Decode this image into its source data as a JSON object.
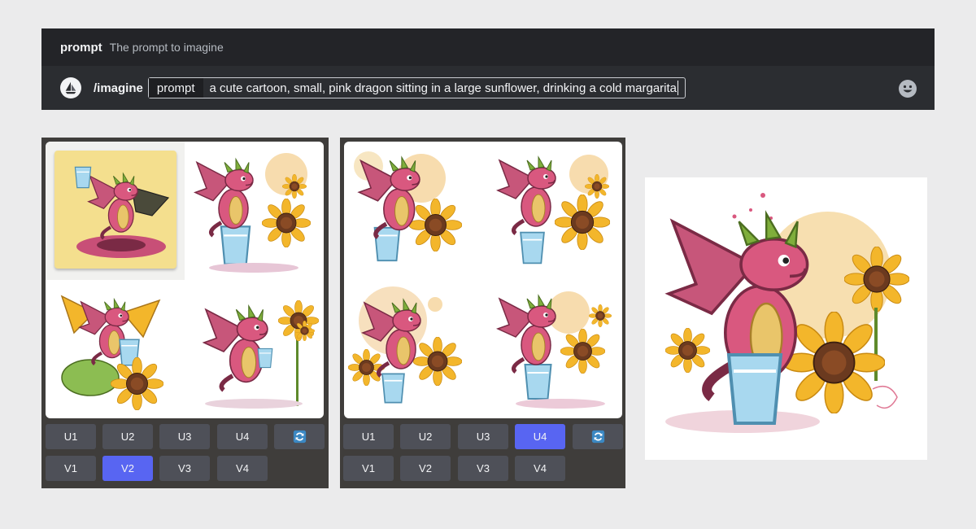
{
  "command": {
    "option_name": "prompt",
    "option_description": "The prompt to imagine",
    "slash_command": "/imagine",
    "prompt_chip": "prompt",
    "prompt_value": "a cute cartoon, small, pink dragon sitting in a large sunflower, drinking a cold margarita"
  },
  "icons": {
    "bot_avatar": "sailboat-icon",
    "emoji": "smiley-emoji-icon",
    "refresh": "refresh-icon"
  },
  "panel_left": {
    "upscale_buttons": [
      "U1",
      "U2",
      "U3",
      "U4"
    ],
    "variation_buttons": [
      "V1",
      "V2",
      "V3",
      "V4"
    ],
    "active_button": "V2"
  },
  "panel_right": {
    "upscale_buttons": [
      "U1",
      "U2",
      "U3",
      "U4"
    ],
    "variation_buttons": [
      "V1",
      "V2",
      "V3",
      "V4"
    ],
    "active_button": "U4"
  },
  "colors": {
    "accent": "#5865f2",
    "button_bg": "#4e5058",
    "bar_bg": "#2b2d31",
    "panel_bg": "#3f3d3b",
    "dragon_pink": "#d9587f",
    "sunflower_yellow": "#f3b62b"
  }
}
